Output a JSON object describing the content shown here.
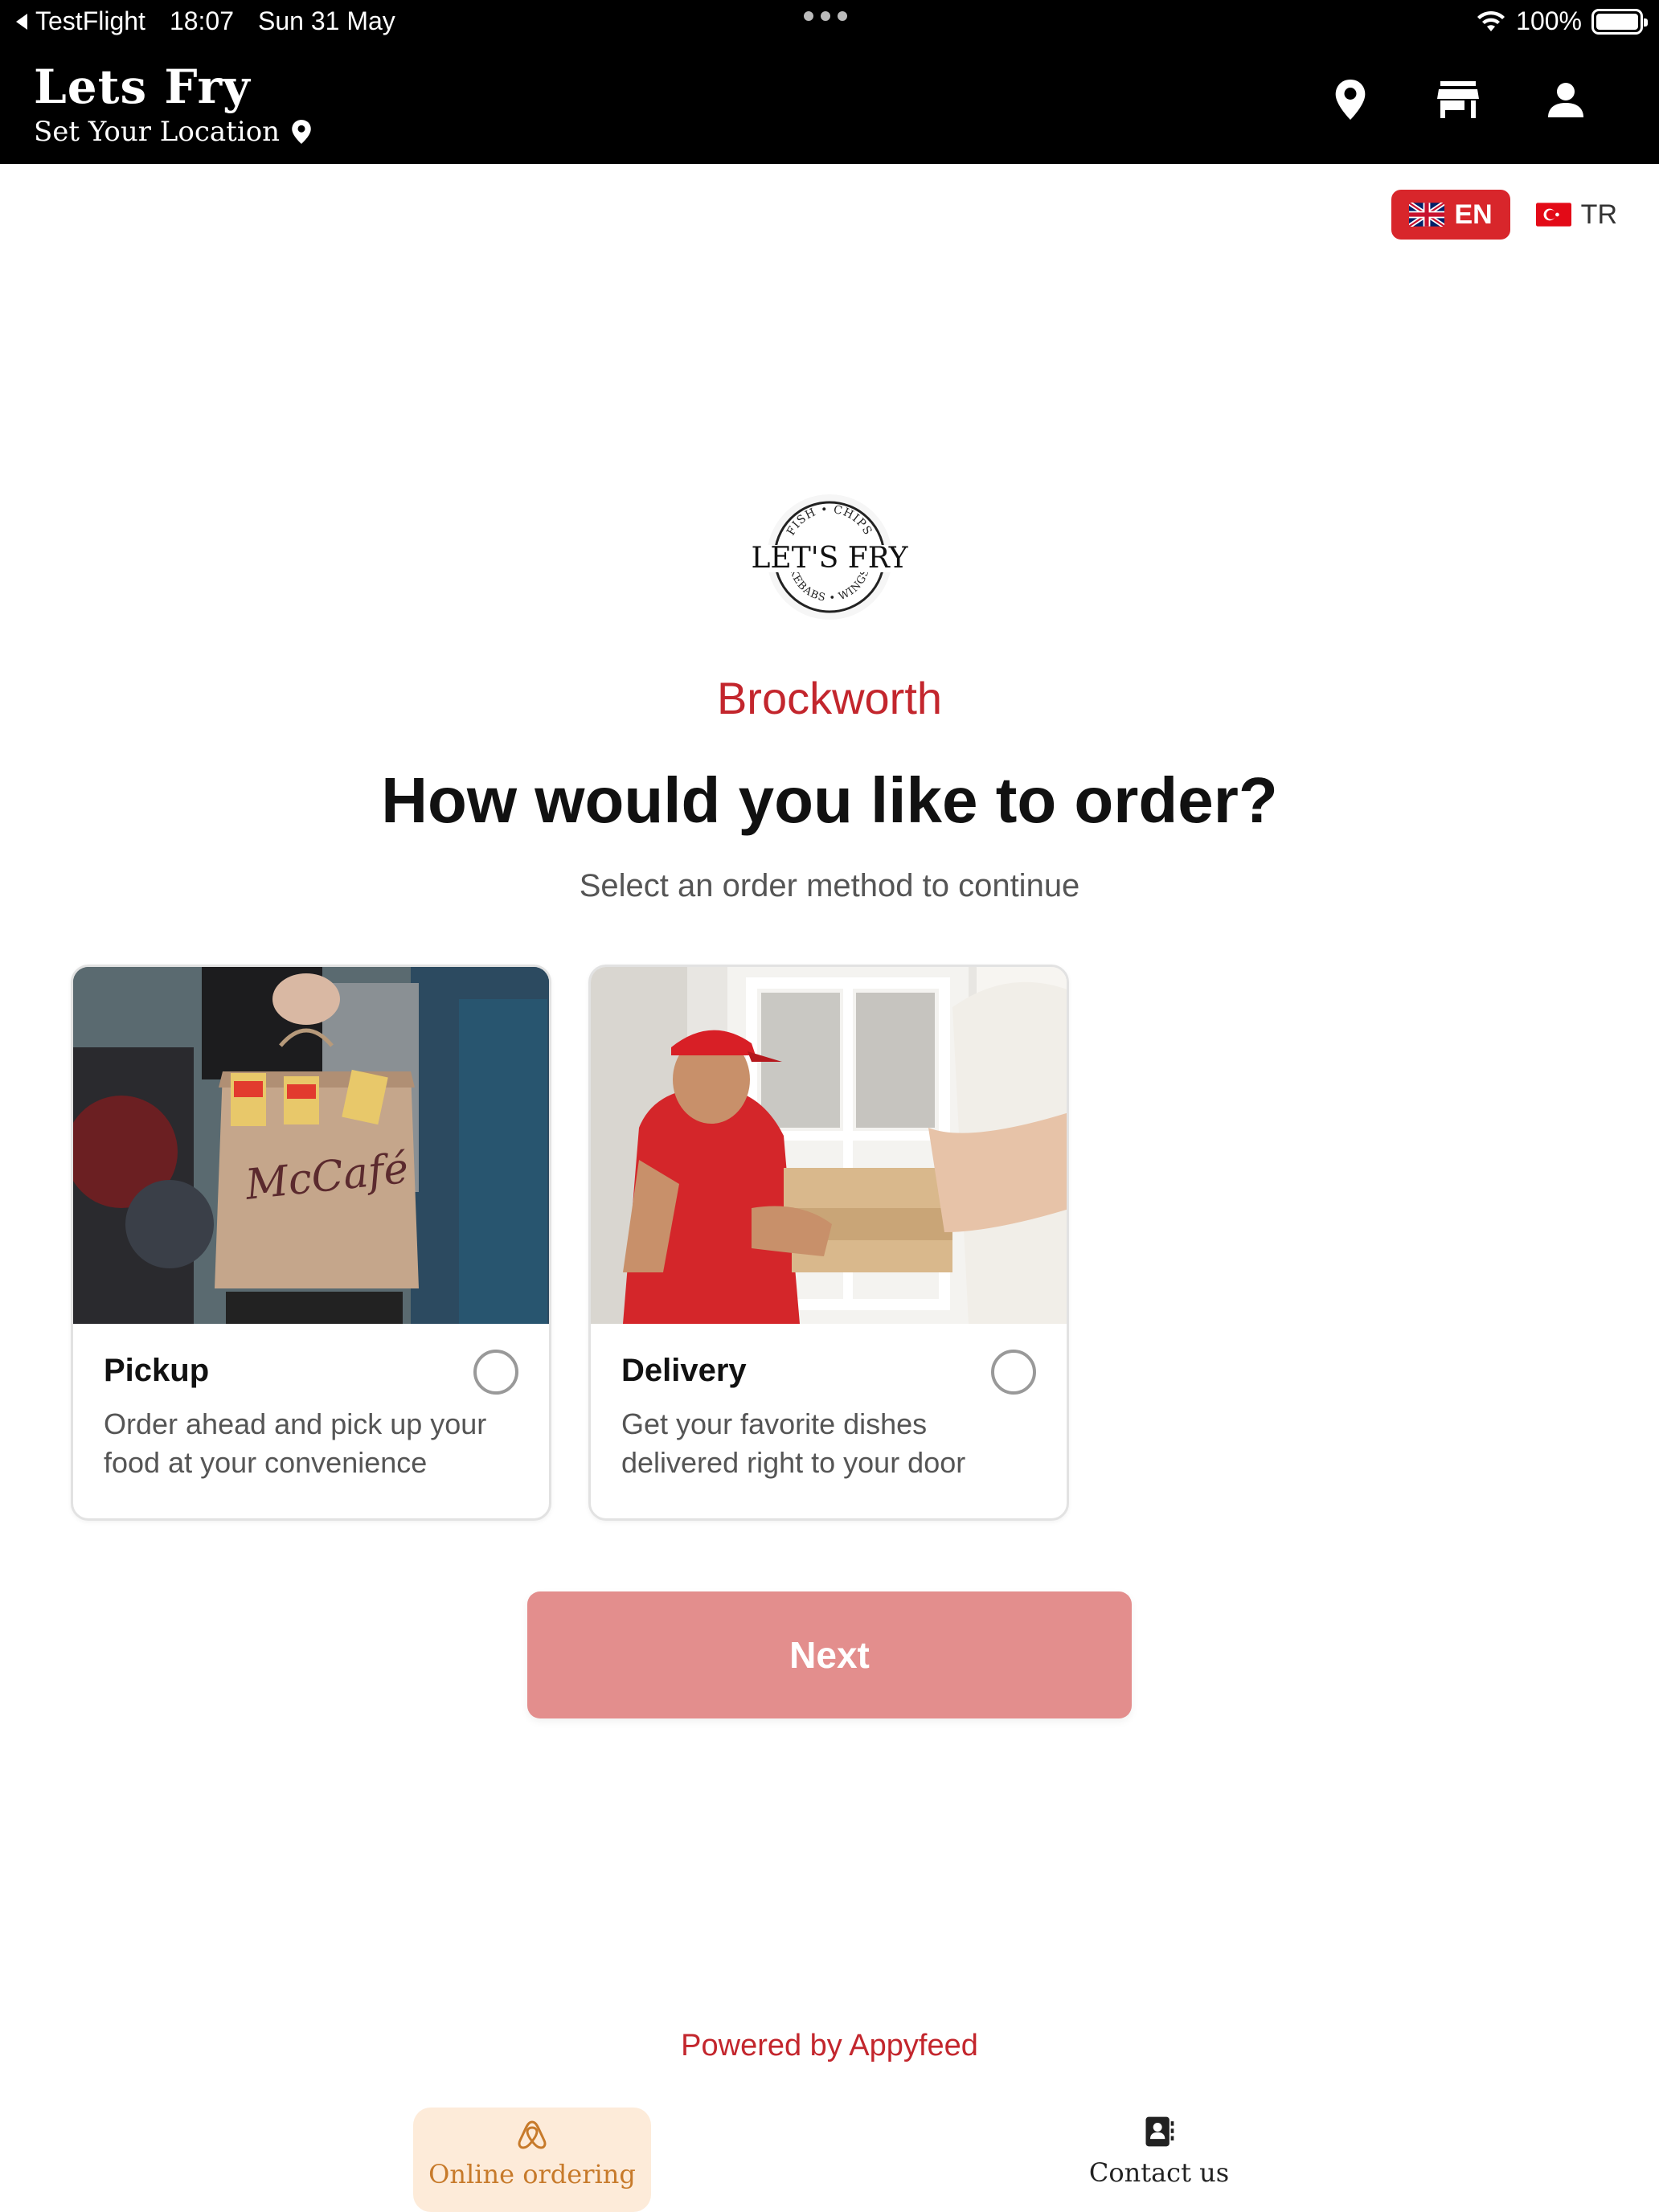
{
  "status_bar": {
    "back_app": "TestFlight",
    "time": "18:07",
    "date": "Sun 31 May",
    "battery": "100%"
  },
  "header": {
    "title": "Lets Fry",
    "location_label": "Set Your Location",
    "icons": [
      "location-pin-icon",
      "store-icon",
      "account-icon"
    ]
  },
  "language": {
    "en_label": "EN",
    "tr_label": "TR",
    "selected": "EN",
    "accent": "#d8262b"
  },
  "logo": {
    "name": "LET'S FRY",
    "top_text": "FISH • CHIPS",
    "bottom_text": "KEBABS • WINGS"
  },
  "store_name": "Brockworth",
  "question": "How would you like to order?",
  "subtitle": "Select an order method to continue",
  "options": [
    {
      "title": "Pickup",
      "description": "Order ahead and pick up your food at your convenience",
      "selected": false,
      "bag_text": "McCafé"
    },
    {
      "title": "Delivery",
      "description": "Get your favorite dishes delivered right to your door",
      "selected": false
    }
  ],
  "next_label": "Next",
  "next_color": "#e38e8d",
  "powered_by": "Powered by Appyfeed",
  "bottom_nav": [
    {
      "label": "Online ordering",
      "icon": "airbnb-style-logo-icon",
      "active": true
    },
    {
      "label": "Contact us",
      "icon": "contacts-book-icon",
      "active": false
    }
  ]
}
